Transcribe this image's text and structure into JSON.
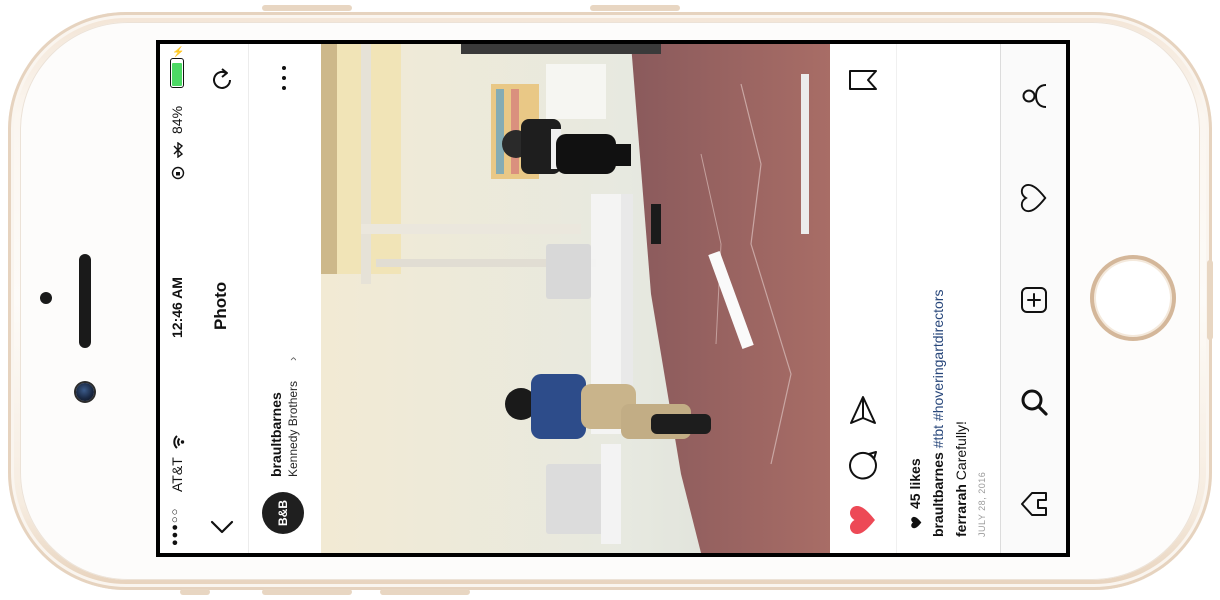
{
  "status": {
    "carrier": "AT&T",
    "signal_dots": "●●●○○",
    "time": "12:46 AM",
    "battery": "84%"
  },
  "header": {
    "title": "Photo",
    "username": "braultbarnes",
    "location": "Kennedy Brothers",
    "avatar_text": "B&B"
  },
  "post": {
    "likes": "45 likes",
    "caption_user": "braultbarnes",
    "caption_tags": "#tbt #hoveringartdirectors",
    "comment_user": "ferrarah",
    "comment_text": "Carefully!",
    "date": "JULY 28, 2016"
  },
  "colors": {
    "like_red": "#ed4956",
    "battery_green": "#4cd964",
    "hashtag_blue": "#27467a"
  },
  "icons": {
    "back": "chevron-left-icon",
    "more": "more-dots-icon",
    "refresh": "refresh-icon",
    "like": "heart-filled-icon",
    "comment": "comment-icon",
    "share": "send-icon",
    "save": "bookmark-icon",
    "tabs": [
      "home-icon",
      "search-icon",
      "plus-square-icon",
      "heart-outline-icon",
      "profile-icon"
    ]
  }
}
